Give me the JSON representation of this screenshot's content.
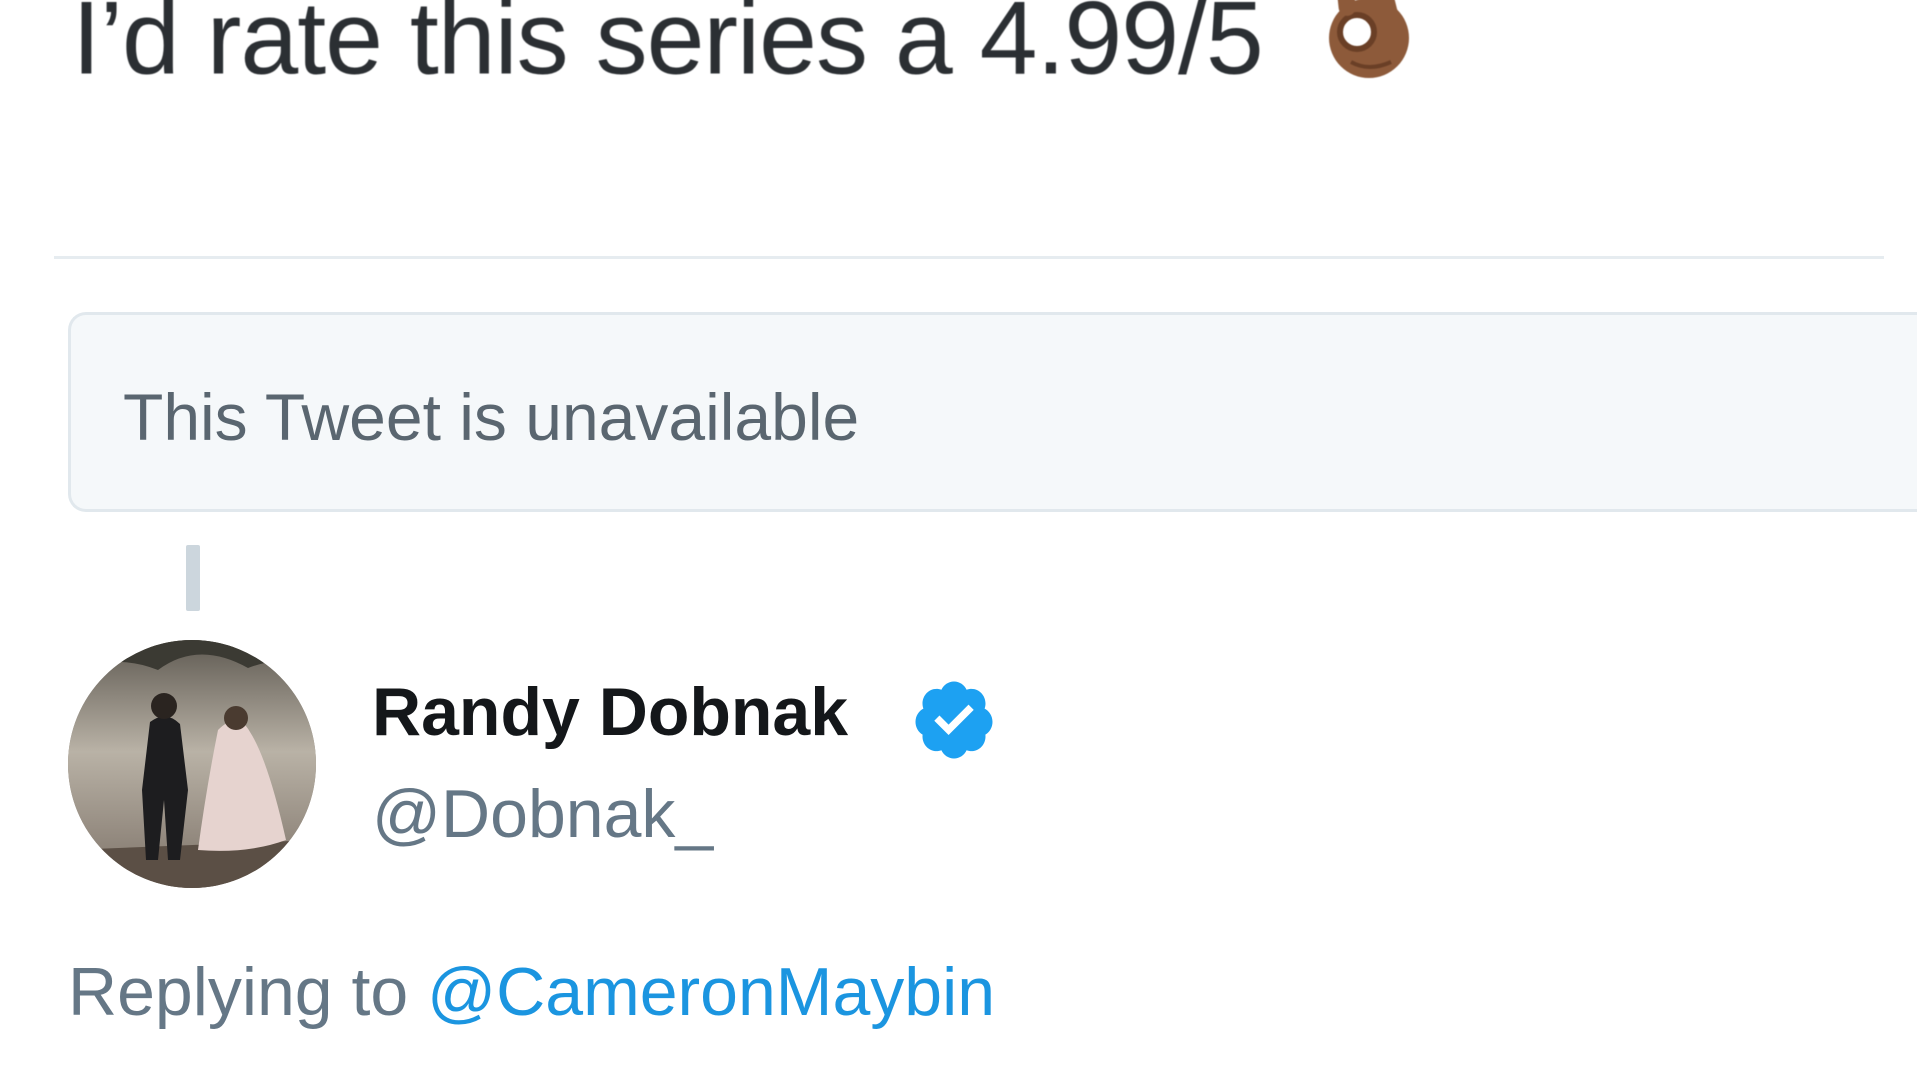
{
  "tweet": {
    "text": "I’d rate this series a 4.99/5",
    "emoji_icon": "ok-hand-icon",
    "emoji_char": "👌"
  },
  "quoted_tweet": {
    "status_text": "This Tweet is unavailable"
  },
  "reply": {
    "author": {
      "display_name": "Randy Dobnak",
      "handle": "@Dobnak_",
      "verified": true,
      "verified_icon": "verified-badge-icon",
      "avatar_icon": "avatar-photo"
    },
    "replying_prefix": "Replying to",
    "replying_to": "@CameronMaybin"
  },
  "colors": {
    "text_primary": "#14171a",
    "text_secondary": "#657786",
    "link": "#1b95e0",
    "verified": "#1da1f2",
    "card_bg": "#f5f8fa",
    "border": "#e1e8ed"
  }
}
